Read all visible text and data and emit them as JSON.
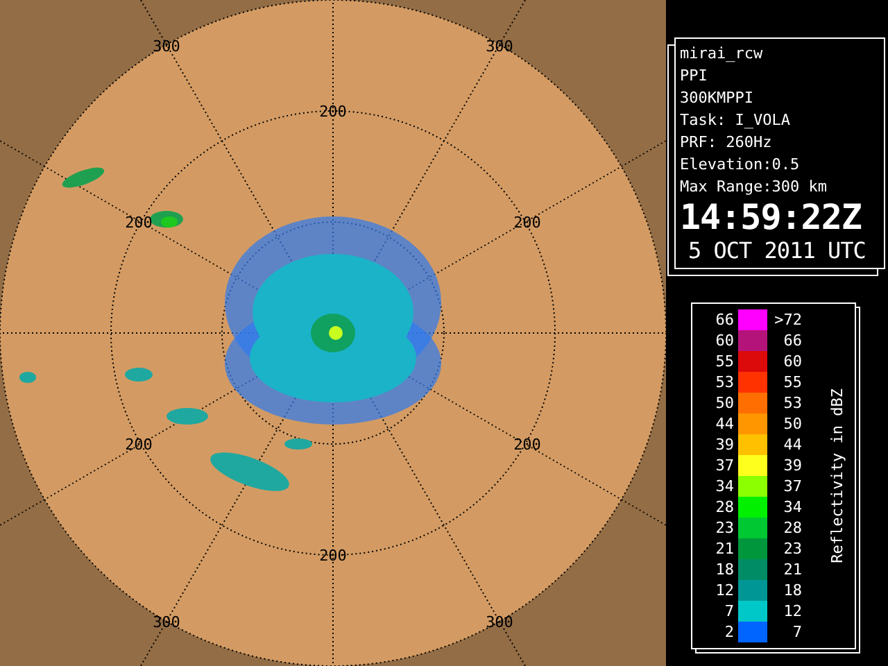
{
  "radar": {
    "ring_labels": [
      "300",
      "300",
      "200",
      "200",
      "200",
      "200",
      "200",
      "200",
      "300",
      "300"
    ]
  },
  "info": {
    "lines": [
      "mirai_rcw",
      "PPI",
      "300KMPPI",
      "Task: I_VOLA",
      "PRF: 260Hz",
      "Elevation:0.5",
      "Max Range:300 km"
    ],
    "time": "14:59:22Z",
    "date": "5 OCT 2011 UTC"
  },
  "legend": {
    "title": "Reflectivity in dBZ",
    "rows": [
      {
        "low": "66",
        "high": ">72",
        "color": "#ff00ff"
      },
      {
        "low": "60",
        "high": "66",
        "color": "#b4147a"
      },
      {
        "low": "55",
        "high": "60",
        "color": "#dc0a0a"
      },
      {
        "low": "53",
        "high": "55",
        "color": "#ff3200"
      },
      {
        "low": "50",
        "high": "53",
        "color": "#ff6e00"
      },
      {
        "low": "44",
        "high": "50",
        "color": "#ff9600"
      },
      {
        "low": "39",
        "high": "44",
        "color": "#ffc000"
      },
      {
        "low": "37",
        "high": "39",
        "color": "#ffff1e"
      },
      {
        "low": "34",
        "high": "37",
        "color": "#8cff00"
      },
      {
        "low": "28",
        "high": "34",
        "color": "#00f000"
      },
      {
        "low": "23",
        "high": "28",
        "color": "#00c832"
      },
      {
        "low": "21",
        "high": "23",
        "color": "#00963c"
      },
      {
        "low": "18",
        "high": "21",
        "color": "#008c64"
      },
      {
        "low": "12",
        "high": "18",
        "color": "#009696"
      },
      {
        "low": "7",
        "high": "12",
        "color": "#00c8c8"
      },
      {
        "low": "2",
        "high": "7",
        "color": "#0064ff"
      }
    ]
  }
}
